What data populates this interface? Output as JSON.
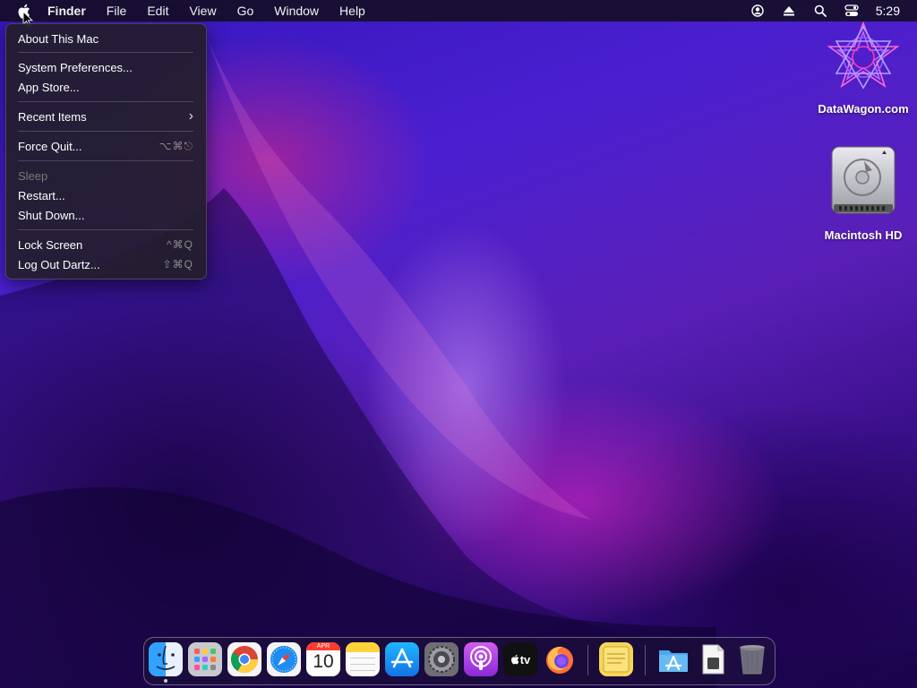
{
  "menubar": {
    "apple_icon": "apple-icon",
    "items": [
      "Finder",
      "File",
      "Edit",
      "View",
      "Go",
      "Window",
      "Help"
    ],
    "status_icons": [
      "user-account-icon",
      "eject-icon",
      "spotlight-search-icon",
      "control-center-icon"
    ],
    "clock": "5:29"
  },
  "apple_menu": {
    "about": "About This Mac",
    "system_prefs": "System Preferences...",
    "app_store": "App Store...",
    "recent_items": "Recent Items",
    "recent_items_arrow": "›",
    "force_quit": "Force Quit...",
    "force_quit_shortcut": "⌥⌘⎋",
    "sleep": "Sleep",
    "restart": "Restart...",
    "shut_down": "Shut Down...",
    "lock_screen": "Lock Screen",
    "lock_screen_shortcut": "^⌘Q",
    "log_out": "Log Out Dartz...",
    "log_out_shortcut": "⇧⌘Q"
  },
  "desktop": {
    "icons": [
      {
        "label": "DataWagon.com",
        "icon": "datawagon-logo-icon"
      },
      {
        "label": "Macintosh HD",
        "icon": "hard-drive-icon"
      }
    ]
  },
  "dock": {
    "apps": [
      {
        "name": "Finder",
        "icon": "finder-icon",
        "running": true
      },
      {
        "name": "Launchpad",
        "icon": "launchpad-icon"
      },
      {
        "name": "Google Chrome",
        "icon": "chrome-icon"
      },
      {
        "name": "Safari",
        "icon": "safari-icon"
      },
      {
        "name": "Calendar",
        "icon": "calendar-icon"
      },
      {
        "name": "Notes",
        "icon": "notes-icon"
      },
      {
        "name": "App Store",
        "icon": "app-store-icon"
      },
      {
        "name": "System Preferences",
        "icon": "system-preferences-icon"
      },
      {
        "name": "Podcasts",
        "icon": "podcasts-icon"
      },
      {
        "name": "Apple TV",
        "icon": "apple-tv-icon"
      },
      {
        "name": "Firefox",
        "icon": "firefox-icon"
      },
      {
        "name": "Stickies",
        "icon": "stickies-icon"
      },
      {
        "name": "Applications",
        "icon": "applications-folder-icon"
      },
      {
        "name": "Document",
        "icon": "document-icon"
      },
      {
        "name": "Trash",
        "icon": "trash-icon"
      }
    ],
    "calendar_month": "APR",
    "calendar_day": "10",
    "tv_label": "tv"
  },
  "colors": {
    "menubar_bg": "#160e28",
    "menu_bg": "#241e2c",
    "desktop_blue": "#4a1fd0",
    "desktop_magenta": "#e628c8"
  }
}
